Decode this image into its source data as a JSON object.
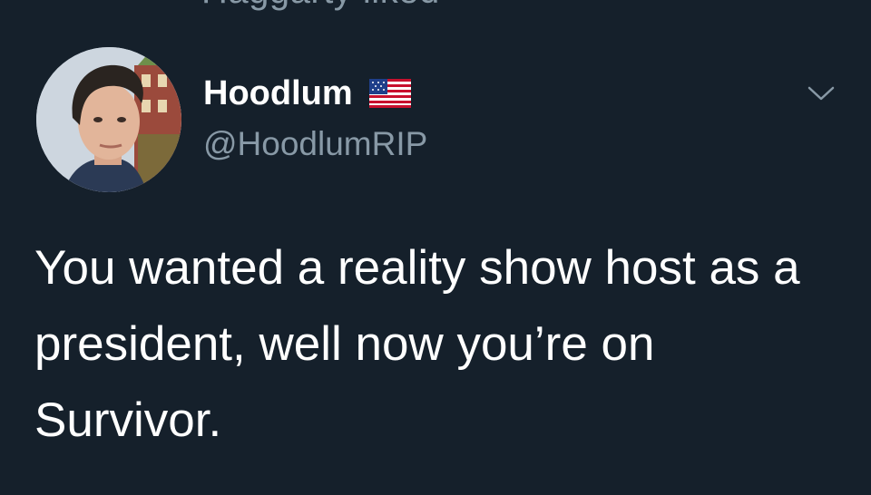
{
  "context": {
    "liked_by_text": "Haggarty liked"
  },
  "tweet": {
    "author": {
      "display_name": "Hoodlum",
      "handle": "@HoodlumRIP",
      "badge_icon": "us-flag-icon",
      "avatar_icon": "avatar-portrait"
    },
    "text": "You wanted a reality show host as a president, well now you’re on Survivor.",
    "more_icon": "chevron-down-icon"
  },
  "colors": {
    "background": "#15202b",
    "primary_text": "#ffffff",
    "secondary_text": "#8899a6"
  }
}
